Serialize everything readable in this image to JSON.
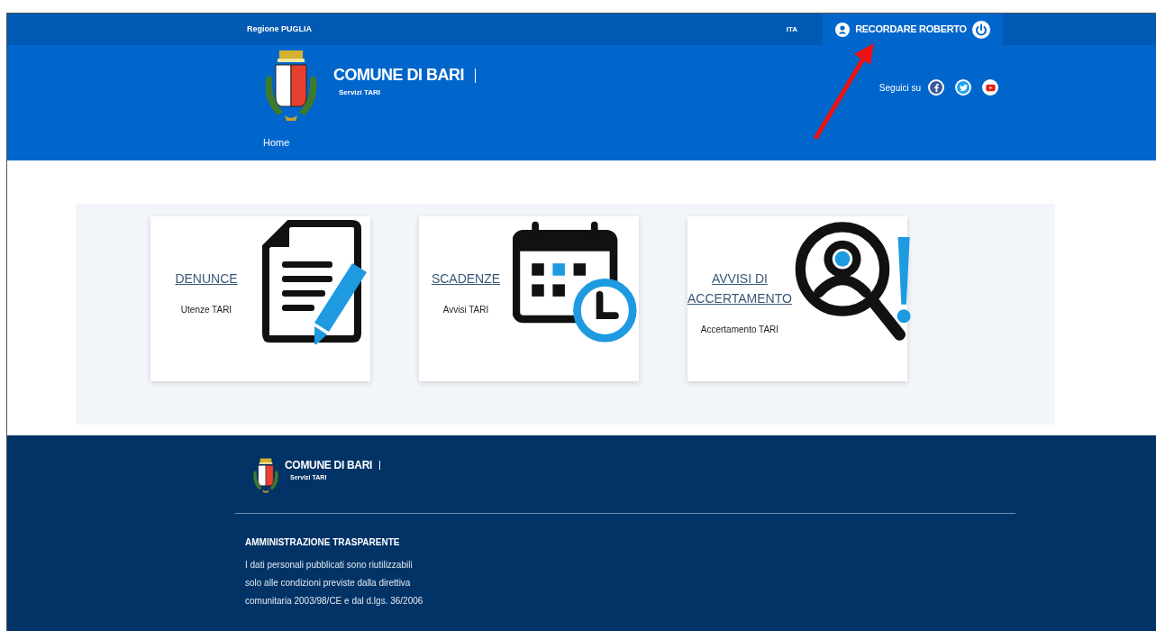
{
  "top_bar": {
    "region": "Regione PUGLIA",
    "language": "ITA",
    "user": "RECORDARE ROBERTO"
  },
  "header": {
    "title": "COMUNE DI BARI",
    "subtitle": "Servizi TARI",
    "social_label": "Seguici su",
    "nav": [
      {
        "label": "Home"
      }
    ]
  },
  "cards": [
    {
      "kind": "document",
      "title": "DENUNCE",
      "subtitle": "Utenze TARI"
    },
    {
      "kind": "calendar",
      "title": "SCADENZE",
      "subtitle": "Avvisi TARI"
    },
    {
      "kind": "search-person",
      "title": "AVVISI DI ACCERTAMENTO",
      "subtitle": "Accertamento TARI"
    }
  ],
  "footer": {
    "title": "COMUNE DI BARI",
    "subtitle": "Servizi TARI",
    "section_title": "AMMINISTRAZIONE TRASPARENTE",
    "text": "I dati personali pubblicati sono riutilizzabili solo alle condizioni previste dalla direttiva comunitaria 2003/98/CE e dal d.lgs. 36/2006"
  }
}
